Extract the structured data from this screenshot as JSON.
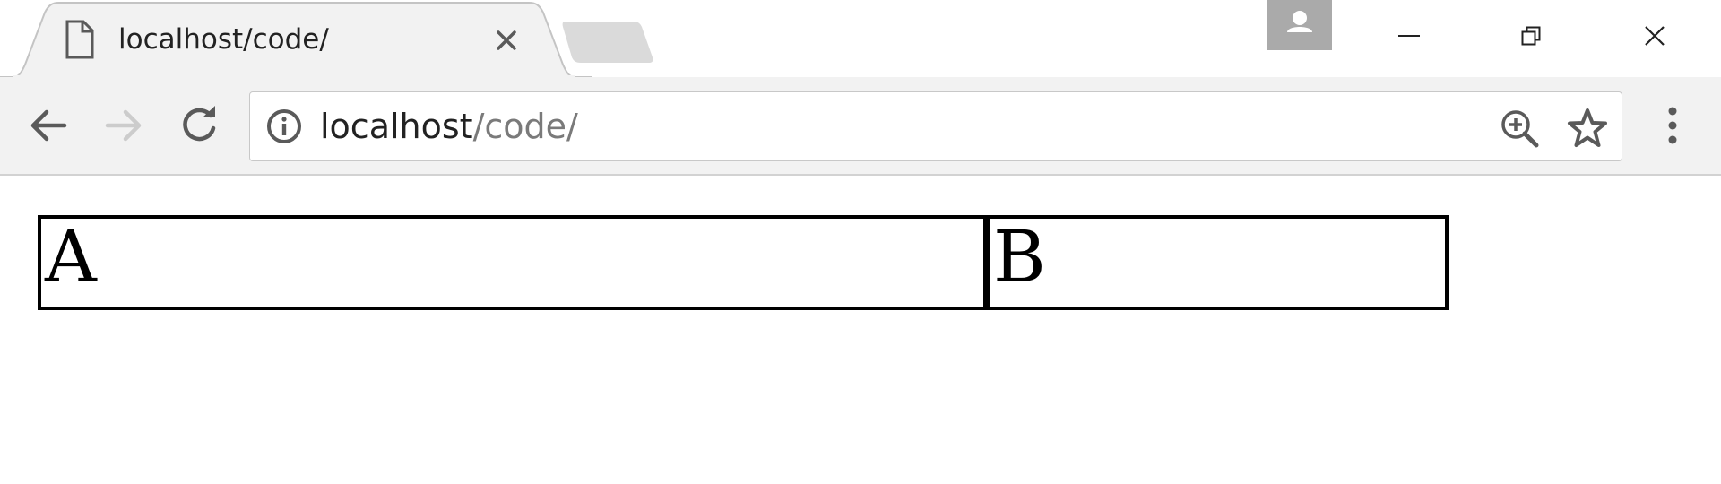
{
  "tab": {
    "title": "localhost/code/",
    "page_icon": "page-icon",
    "close_icon": "close-icon"
  },
  "new_tab": {
    "icon": "new-tab-icon"
  },
  "profile": {
    "icon": "person-icon"
  },
  "window_controls": {
    "minimize_icon": "minimize-icon",
    "restore_icon": "restore-icon",
    "close_icon": "close-icon"
  },
  "toolbar": {
    "back_icon": "back-arrow-icon",
    "forward_icon": "forward-arrow-icon",
    "forward_enabled": false,
    "reload_icon": "reload-icon",
    "menu_icon": "more-vertical-icon"
  },
  "omnibox": {
    "security_icon": "info-icon",
    "url_host": "localhost",
    "url_path": "/code/",
    "zoom_icon": "zoom-in-icon",
    "bookmark_icon": "star-icon"
  },
  "page": {
    "table": {
      "cells": [
        "A",
        "B"
      ]
    }
  },
  "colors": {
    "tab_active_bg": "#f2f2f2",
    "toolbar_bg": "#f2f2f2",
    "tab_inactive": "#dadada",
    "profile_bg": "#aaaaaa",
    "icon": "#5a5a5a",
    "icon_disabled": "#cccccc",
    "url_host": "#222222",
    "url_path": "#7a7a7a"
  }
}
